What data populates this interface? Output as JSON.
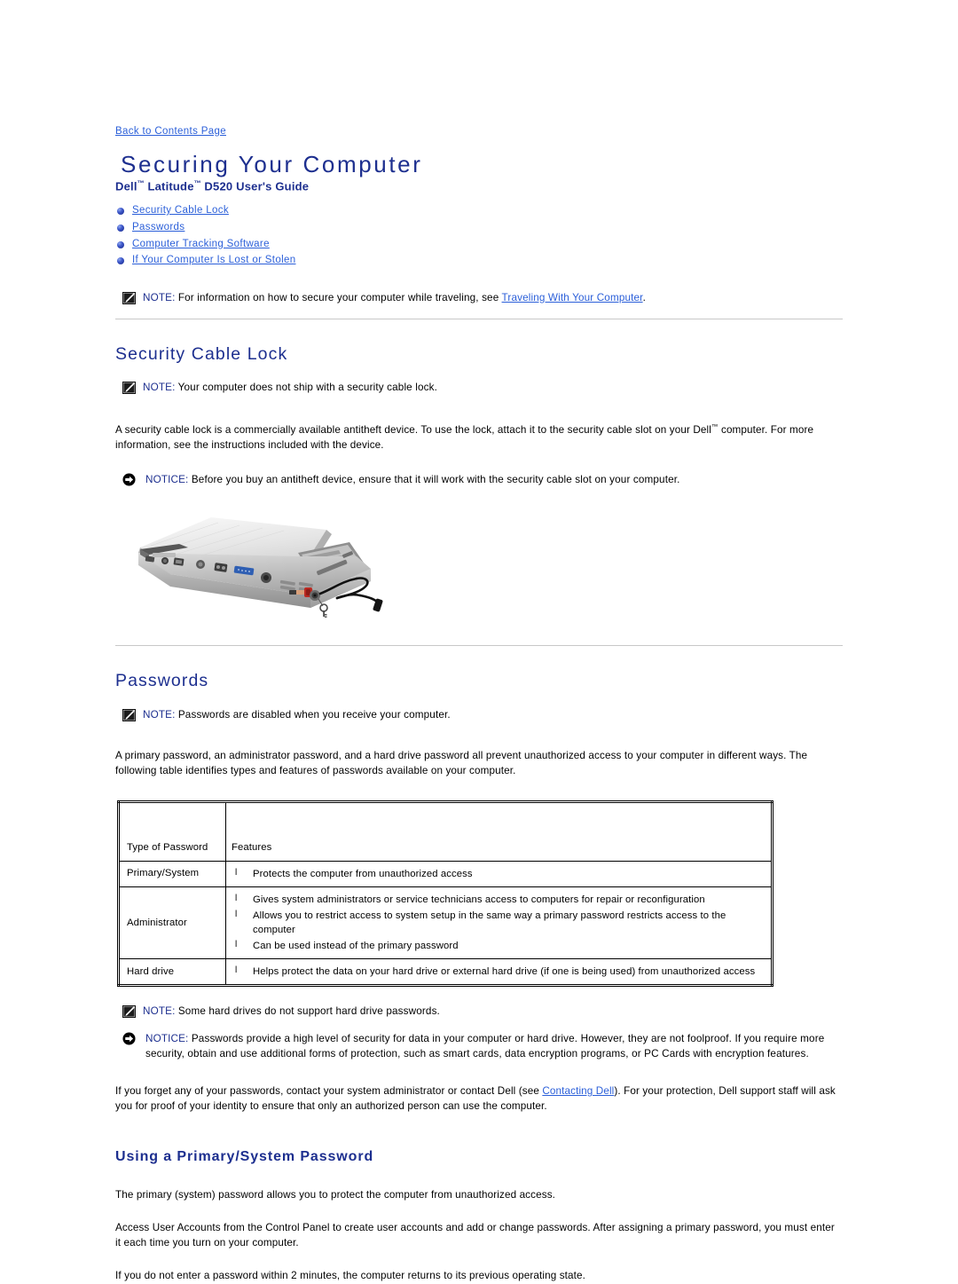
{
  "back_link": "Back to Contents Page",
  "title": "Securing Your Computer",
  "subtitle_pre": "Dell",
  "subtitle_tm1": "™",
  "subtitle_mid": " Latitude",
  "subtitle_tm2": "™",
  "subtitle_post": " D520 User's Guide",
  "toc": [
    {
      "label": "Security Cable Lock"
    },
    {
      "label": "Passwords"
    },
    {
      "label": "Computer Tracking Software"
    },
    {
      "label": "If Your Computer Is Lost or Stolen"
    }
  ],
  "intro_note": {
    "label": "NOTE:",
    "text_before": " For information on how to secure your computer while traveling, see ",
    "link": "Traveling With Your Computer",
    "text_after": "."
  },
  "section_cable": {
    "heading": "Security Cable Lock",
    "note": {
      "label": "NOTE:",
      "text": " Your computer does not ship with a security cable lock."
    },
    "paragraph_pre": "A security cable lock is a commercially available antitheft device. To use the lock, attach it to the security cable slot on your Dell",
    "paragraph_tm": "™",
    "paragraph_post": " computer. For more information, see the instructions included with the device.",
    "notice": {
      "label": "NOTICE:",
      "text": " Before you buy an antitheft device, ensure that it will work with the security cable slot on your computer."
    },
    "image_alt": "Rear view of Dell Latitude D520 laptop with security cable lock attached"
  },
  "section_passwords": {
    "heading": "Passwords",
    "note": {
      "label": "NOTE:",
      "text": " Passwords are disabled when you receive your computer."
    },
    "paragraph": "A primary password, an administrator password, and a hard drive password all prevent unauthorized access to your computer in different ways. The following table identifies types and features of passwords available on your computer.",
    "table": {
      "headers": [
        "Type of Password",
        "Features"
      ],
      "rows": [
        {
          "type": "Primary/System",
          "features": [
            "Protects the computer from unauthorized access"
          ]
        },
        {
          "type": "Administrator",
          "features": [
            "Gives system administrators or service technicians access to computers for repair or reconfiguration",
            "Allows you to restrict access to system setup in the same way a primary password restricts access to the computer",
            "Can be used instead of the primary password"
          ]
        },
        {
          "type": "Hard drive",
          "features": [
            "Helps protect the data on your hard drive or external hard drive (if one is being used) from unauthorized access"
          ]
        }
      ]
    },
    "note2": {
      "label": "NOTE:",
      "text": " Some hard drives do not support hard drive passwords."
    },
    "notice": {
      "label": "NOTICE:",
      "text": " Passwords provide a high level of security for data in your computer or hard drive. However, they are not foolproof. If you require more security, obtain and use additional forms of protection, such as smart cards, data encryption programs, or PC Cards with encryption features."
    },
    "forgot_pre": "If you forget any of your passwords, contact your system administrator or contact Dell (see ",
    "forgot_link": "Contacting Dell",
    "forgot_post": "). For your protection, Dell support staff will ask you for proof of your identity to ensure that only an authorized person can use the computer."
  },
  "section_primary": {
    "heading": "Using a Primary/System Password",
    "p1": "The primary (system) password allows you to protect the computer from unauthorized access.",
    "p2": "Access User Accounts from the Control Panel to create user accounts and add or change passwords. After assigning a primary password, you must enter it each time you turn on your computer.",
    "p3": "If you do not enter a password within 2 minutes, the computer returns to its previous operating state."
  },
  "colors": {
    "heading_blue": "#1d2f8f",
    "link_blue": "#2b5fd9",
    "rule_gray": "#c8c8c8"
  }
}
